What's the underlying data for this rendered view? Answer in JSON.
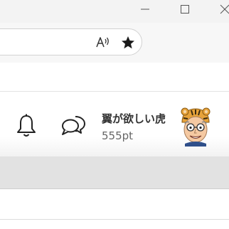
{
  "window_controls": {
    "minimize_icon": "minimize-icon",
    "maximize_icon": "maximize-icon",
    "close_icon": "close-icon"
  },
  "address_bar": {
    "read_aloud_icon": "read-aloud-icon",
    "favorite_icon": "star-filled-icon"
  },
  "header": {
    "notifications_icon": "bell-icon",
    "messages_icon": "chat-bubbles-icon",
    "user": {
      "name": "翼が欲しい虎",
      "points": "555pt",
      "avatar_icon": "tiger-hat-avatar"
    }
  },
  "colors": {
    "titlebar_bg": "#f3f3f3",
    "band_grey": "#e2e2e2",
    "text_dark": "#333333",
    "text_muted": "#666666",
    "avatar_accent": "#e8a33a"
  }
}
